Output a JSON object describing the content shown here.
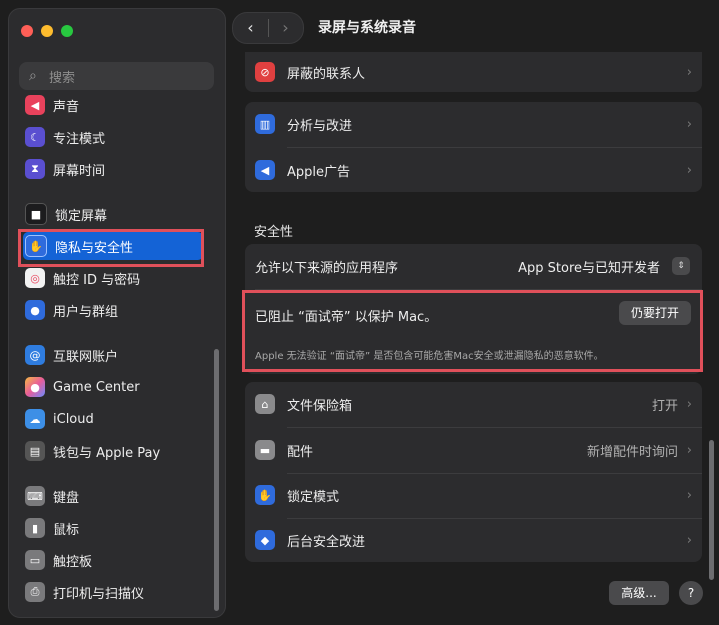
{
  "window": {
    "title": "录屏与系统录音"
  },
  "search": {
    "placeholder": "搜索"
  },
  "sidebar": {
    "items": [
      {
        "label": "声音",
        "icon": "speaker-icon",
        "color": "#e9425c"
      },
      {
        "label": "专注模式",
        "icon": "moon-icon",
        "color": "#5a4fd0"
      },
      {
        "label": "屏幕时间",
        "icon": "hourglass-icon",
        "color": "#5a4fd0"
      },
      {
        "label": "锁定屏幕",
        "icon": "lock-icon",
        "color": "#1c1c1e"
      },
      {
        "label": "隐私与安全性",
        "icon": "hand-icon",
        "color": "#2f6bdc"
      },
      {
        "label": "触控 ID 与密码",
        "icon": "fingerprint-icon",
        "color": "#f2f2f2"
      },
      {
        "label": "用户与群组",
        "icon": "users-icon",
        "color": "#2f6bdc"
      },
      {
        "label": "互联网账户",
        "icon": "at-icon",
        "color": "#2f7de0"
      },
      {
        "label": "Game Center",
        "icon": "gamecenter-icon",
        "color": "#e85d9a"
      },
      {
        "label": "iCloud",
        "icon": "cloud-icon",
        "color": "#3d8fe6"
      },
      {
        "label": "钱包与 Apple Pay",
        "icon": "wallet-icon",
        "color": "#555"
      },
      {
        "label": "键盘",
        "icon": "keyboard-icon",
        "color": "#7a7a7c"
      },
      {
        "label": "鼠标",
        "icon": "mouse-icon",
        "color": "#7a7a7c"
      },
      {
        "label": "触控板",
        "icon": "trackpad-icon",
        "color": "#7a7a7c"
      },
      {
        "label": "打印机与扫描仪",
        "icon": "printer-icon",
        "color": "#7a7a7c"
      }
    ]
  },
  "main": {
    "rows_top": [
      {
        "label": "屏蔽的联系人",
        "icon": "block-icon",
        "color": "#e04040"
      }
    ],
    "rows_mid": [
      {
        "label": "分析与改进",
        "icon": "chart-icon",
        "color": "#2f6bdc"
      },
      {
        "label": "Apple广告",
        "icon": "megaphone-icon",
        "color": "#2f6bdc"
      }
    ],
    "security": {
      "heading": "安全性",
      "allow_label": "允许以下来源的应用程序",
      "allow_value": "App Store与已知开发者",
      "blocked_text": "已阻止 “面试帝” 以保护 Mac。",
      "open_anyway": "仍要打开",
      "note": "Apple 无法验证 “面试帝” 是否包含可能危害Mac安全或泄漏隐私的恶意软件。"
    },
    "rows_bottom": [
      {
        "label": "文件保险箱",
        "value": "打开",
        "icon": "vault-icon",
        "color": "#8a8a8c"
      },
      {
        "label": "配件",
        "value": "新增配件时询问",
        "icon": "accessory-icon",
        "color": "#8a8a8c"
      },
      {
        "label": "锁定模式",
        "value": "",
        "icon": "hand-icon",
        "color": "#2f6bdc"
      },
      {
        "label": "后台安全改进",
        "value": "",
        "icon": "shield-icon",
        "color": "#2f6bdc"
      }
    ],
    "advanced_button": "高级...",
    "help_button": "?"
  },
  "colors": {
    "accent": "#1463d6",
    "highlight": "#e0505a"
  }
}
